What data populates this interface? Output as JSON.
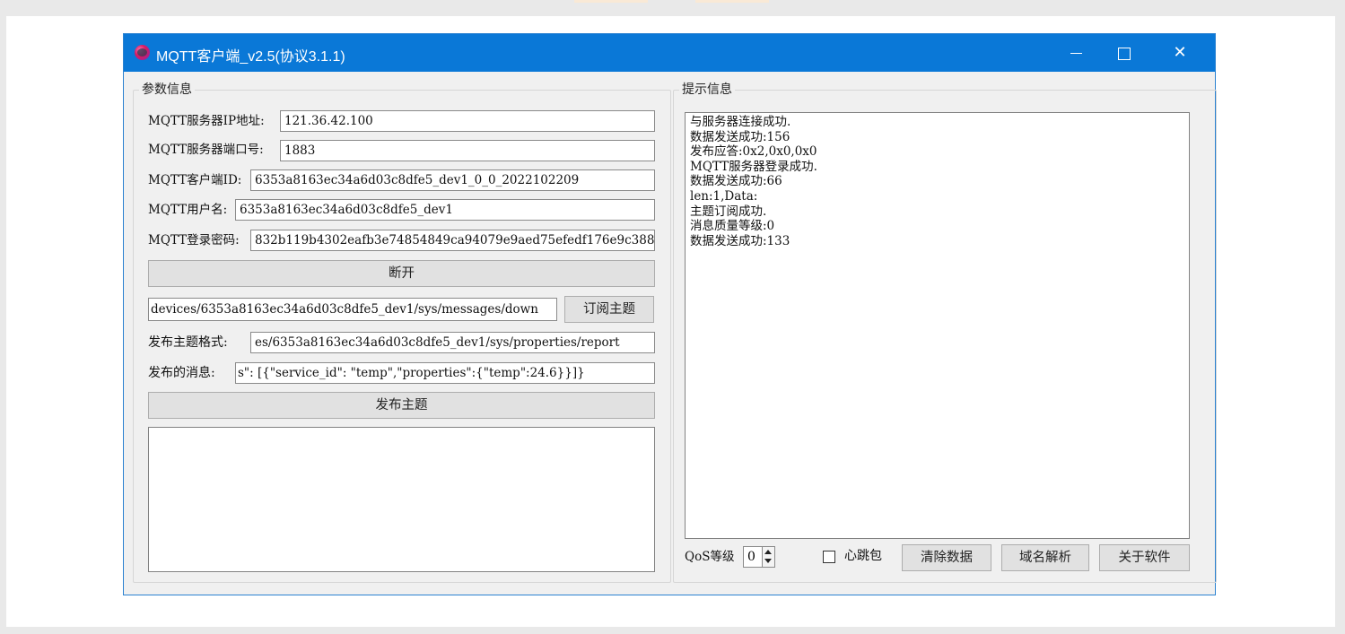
{
  "window": {
    "title": "MQTT客户端_v2.5(协议3.1.1)"
  },
  "params": {
    "group_title": "参数信息",
    "server_ip_label": "MQTT服务器IP地址:",
    "server_ip_value": "121.36.42.100",
    "server_port_label": "MQTT服务器端口号:",
    "server_port_value": "1883",
    "client_id_label": "MQTT客户端ID:",
    "client_id_value": "6353a8163ec34a6d03c8dfe5_dev1_0_0_2022102209",
    "username_label": "MQTT用户名:",
    "username_value": "6353a8163ec34a6d03c8dfe5_dev1",
    "password_label": "MQTT登录密码:",
    "password_value": "832b119b4302eafb3e74854849ca94079e9aed75efedf176e9c388",
    "disconnect_label": "断开",
    "subscribe_topic_value": "devices/6353a8163ec34a6d03c8dfe5_dev1/sys/messages/down",
    "subscribe_label": "订阅主题",
    "publish_topic_label": "发布主题格式:",
    "publish_topic_value": "es/6353a8163ec34a6d03c8dfe5_dev1/sys/properties/report",
    "publish_msg_label": "发布的消息:",
    "publish_msg_value": "s\": [{\"service_id\": \"temp\",\"properties\":{\"temp\":24.6}}]}",
    "publish_label": "发布主题",
    "receive_area_value": ""
  },
  "info": {
    "group_title": "提示信息",
    "log_lines": [
      "与服务器连接成功.",
      "数据发送成功:156",
      "发布应答:0x2,0x0,0x0",
      "MQTT服务器登录成功.",
      "数据发送成功:66",
      "len:1,Data:",
      "主题订阅成功.",
      "消息质量等级:0",
      "数据发送成功:133"
    ],
    "qos_label": "QoS等级",
    "qos_value": "0",
    "heartbeat_label": "心跳包",
    "heartbeat_checked": false,
    "clear_label": "清除数据",
    "dns_label": "域名解析",
    "about_label": "关于软件"
  }
}
